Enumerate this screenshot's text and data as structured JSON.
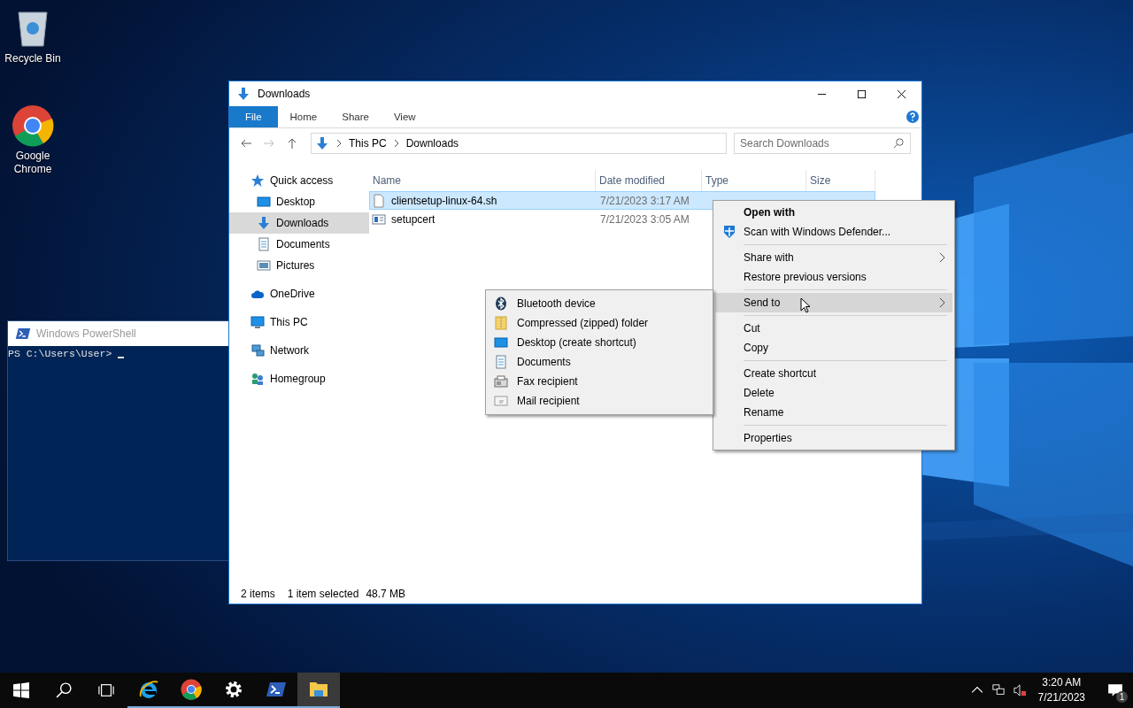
{
  "desktop_icons": [
    {
      "label": "Recycle Bin",
      "kind": "recycle"
    },
    {
      "label": "Google Chrome",
      "kind": "chrome"
    }
  ],
  "powershell": {
    "title": "Windows PowerShell",
    "prompt": "PS C:\\Users\\User>"
  },
  "explorer": {
    "title": "Downloads",
    "ribbon_tabs": [
      {
        "label": "File",
        "selected": true
      },
      {
        "label": "Home",
        "selected": false
      },
      {
        "label": "Share",
        "selected": false
      },
      {
        "label": "View",
        "selected": false
      }
    ],
    "address": [
      "This PC",
      "Downloads"
    ],
    "search": {
      "placeholder": "Search Downloads"
    },
    "nav": [
      {
        "label": "Quick access",
        "kind": "star",
        "selected": false,
        "children": [
          {
            "label": "Desktop",
            "kind": "desktop",
            "selected": false
          },
          {
            "label": "Downloads",
            "kind": "download",
            "selected": true
          },
          {
            "label": "Documents",
            "kind": "documents",
            "selected": false
          },
          {
            "label": "Pictures",
            "kind": "pictures",
            "selected": false
          }
        ]
      },
      {
        "label": "OneDrive",
        "kind": "cloud",
        "selected": false
      },
      {
        "label": "This PC",
        "kind": "pc",
        "selected": false
      },
      {
        "label": "Network",
        "kind": "network",
        "selected": false
      },
      {
        "label": "Homegroup",
        "kind": "homegroup",
        "selected": false
      }
    ],
    "columns": [
      "Name",
      "Date modified",
      "Type",
      "Size"
    ],
    "files": [
      {
        "name": "clientsetup-linux-64.sh",
        "date": "7/21/2023 3:17 AM",
        "kind": "file",
        "selected": true
      },
      {
        "name": "setupcert",
        "date": "7/21/2023 3:05 AM",
        "kind": "cert",
        "selected": false
      }
    ],
    "status": {
      "count": "2 items",
      "selection": "1 item selected",
      "size": "48.7 MB"
    }
  },
  "context_menu": [
    {
      "kind": "header",
      "label": "Open with",
      "selected": false
    },
    {
      "kind": "scan",
      "label": "Scan with Windows Defender...",
      "selected": false
    },
    {
      "kind": "separator"
    },
    {
      "kind": "submenu",
      "label": "Share with",
      "selected": false
    },
    {
      "kind": "item",
      "label": "Restore previous versions",
      "selected": false
    },
    {
      "kind": "separator"
    },
    {
      "kind": "submenu",
      "label": "Send to",
      "selected": true
    },
    {
      "kind": "separator"
    },
    {
      "kind": "item",
      "label": "Cut",
      "selected": false
    },
    {
      "kind": "item",
      "label": "Copy",
      "selected": false
    },
    {
      "kind": "separator"
    },
    {
      "kind": "item",
      "label": "Create shortcut",
      "selected": false
    },
    {
      "kind": "item",
      "label": "Delete",
      "selected": false
    },
    {
      "kind": "item",
      "label": "Rename",
      "selected": false
    },
    {
      "kind": "separator"
    },
    {
      "kind": "item",
      "label": "Properties",
      "selected": false
    }
  ],
  "send_to": [
    {
      "label": "Bluetooth device",
      "kind": "bluetooth"
    },
    {
      "label": "Compressed (zipped) folder",
      "kind": "zip"
    },
    {
      "label": "Desktop (create shortcut)",
      "kind": "desktop"
    },
    {
      "label": "Documents",
      "kind": "documents"
    },
    {
      "label": "Fax recipient",
      "kind": "fax"
    },
    {
      "label": "Mail recipient",
      "kind": "mail"
    }
  ],
  "taskbar": {
    "apps": [
      {
        "kind": "ie",
        "active": false
      },
      {
        "kind": "chrome",
        "active": false
      },
      {
        "kind": "settings",
        "active": false
      },
      {
        "kind": "powershell",
        "active": false
      },
      {
        "kind": "explorer",
        "active": true
      }
    ],
    "time": "3:20 AM",
    "date": "7/21/2023",
    "notifications": "1"
  }
}
